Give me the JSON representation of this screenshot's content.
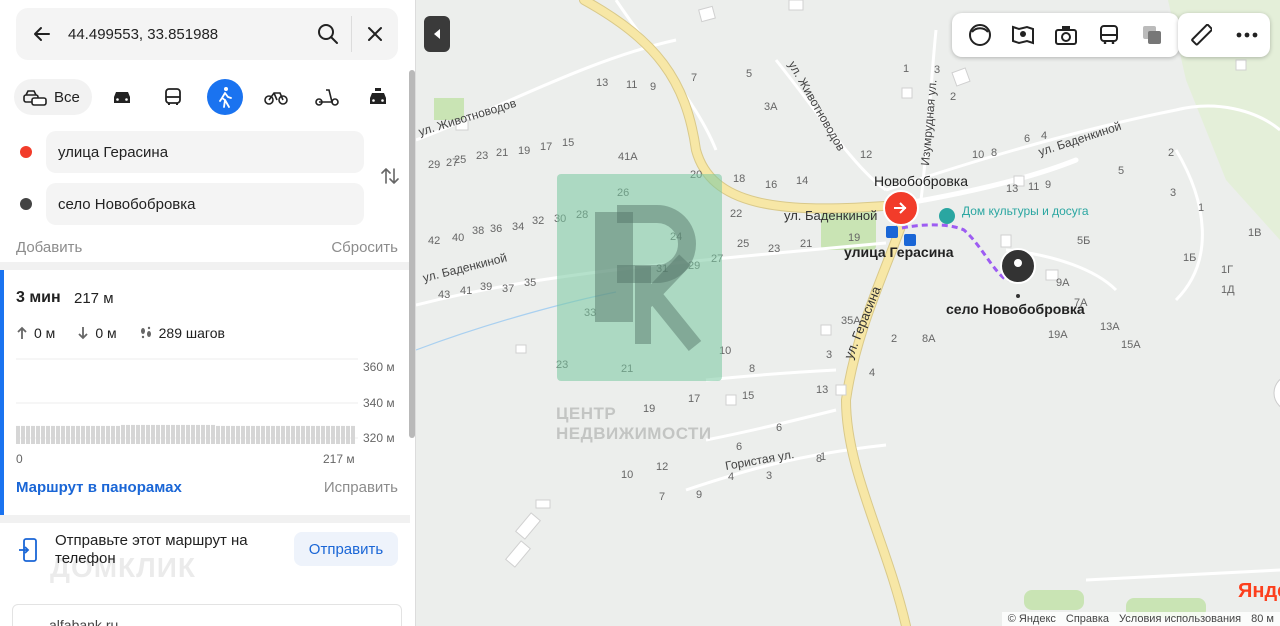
{
  "search": {
    "value": "44.499553, 33.851988"
  },
  "modes": {
    "all_label": "Все"
  },
  "waypoints": {
    "from": "улица Герасина",
    "to": "село Новобобровка"
  },
  "actions": {
    "add": "Добавить",
    "reset": "Сбросить"
  },
  "route": {
    "time": "3 мин",
    "distance": "217 м",
    "ascent": "0 м",
    "descent": "0 м",
    "steps": "289 шагов",
    "elevation": {
      "y_labels": [
        "360 м",
        "340 м",
        "320 м"
      ],
      "x_start": "0",
      "x_end": "217 м",
      "profile_level": 0.21
    },
    "panorama_link": "Маршрут в панорамах",
    "fix_link": "Исправить"
  },
  "send": {
    "text": "Отправьте этот маршрут на телефон",
    "button": "Отправить"
  },
  "watermark": "ДОМКЛИК",
  "ad": {
    "text": "alfabank.ru"
  },
  "map": {
    "place_labels": {
      "village_top": "Новобобровка",
      "start_label": "улица Герасина",
      "end_label": "село Новобобровка",
      "poi": "Дом культуры и досуга"
    },
    "streets": {
      "zhivotnovodov_left": "ул. Животноводов",
      "zhivotnovodov_right": "ул. Животноводов",
      "badenkinoy_center": "ул. Баденкиной",
      "badenkinoy_left": "ул. Баденкиной",
      "badenkinoy_right": "ул. Баденкиной",
      "izumrudnaya": "Изумрудная ул.",
      "gerasina": "ул. Герасина",
      "goristaya": "Гористая ул."
    },
    "houses": [
      "13",
      "11",
      "9",
      "7",
      "5",
      "3А",
      "1",
      "3",
      "2",
      "29",
      "27",
      "25",
      "23",
      "21",
      "19",
      "17",
      "15",
      "41А",
      "12",
      "10",
      "8",
      "6",
      "4",
      "2",
      "5",
      "3",
      "1",
      "1В",
      "1Б",
      "1Г",
      "1Д",
      "20",
      "18",
      "16",
      "14",
      "13",
      "11",
      "9",
      "26",
      "24",
      "22",
      "25",
      "23",
      "21",
      "19",
      "5Б",
      "42",
      "40",
      "38",
      "36",
      "34",
      "32",
      "30",
      "28",
      "31",
      "29",
      "27",
      "43",
      "41",
      "39",
      "37",
      "35",
      "9А",
      "7А",
      "13А",
      "19А",
      "15А",
      "33",
      "10",
      "8",
      "6",
      "4",
      "2",
      "3",
      "35А",
      "8А",
      "23",
      "21",
      "19",
      "17",
      "15",
      "13",
      "4",
      "6",
      "8",
      "10",
      "12",
      "9",
      "7",
      "3",
      "1"
    ],
    "watermark_line1": "ЦЕНТР",
    "watermark_line2": "НЕДВИЖИМОСТИ",
    "scale": "80 м",
    "copyright": [
      "© Яндекс",
      "Справка",
      "Условия использования"
    ],
    "brand": "Яндекс"
  },
  "colors": {
    "accent": "#1a73f0",
    "start": "#f23c2a",
    "end": "#333333",
    "route_line": "#9d5cf2",
    "road_main": "#f7e7a6"
  }
}
